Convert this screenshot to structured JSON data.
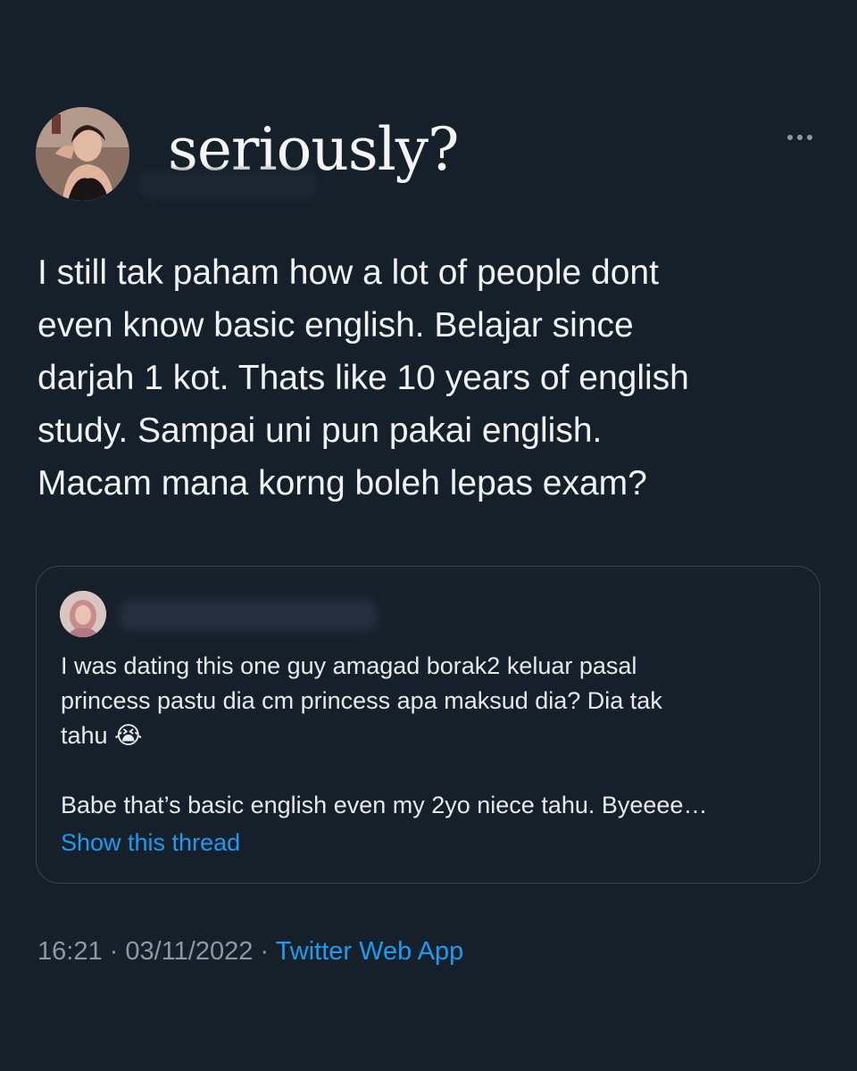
{
  "author": {
    "display_name": "seriously?",
    "avatar_icon": "profile-photo"
  },
  "more_icon": "more-horizontal-icon",
  "tweet": {
    "text": "I still tak paham how a lot of people dont\neven know basic english. Belajar since\ndarjah 1 kot. Thats like 10 years of english\nstudy. Sampai uni pun pakai english.\nMacam mana korng boleh lepas exam?"
  },
  "quoted_tweet": {
    "avatar_icon": "profile-photo",
    "text": "I was dating this one guy amagad borak2 keluar pasal\nprincess pastu dia cm princess apa maksud dia? Dia tak\ntahu 😭\n\nBabe that’s basic english even my 2yo niece tahu. Byeeee…",
    "show_thread_label": "Show this thread"
  },
  "meta": {
    "time": "16:21",
    "separator": "·",
    "date": "03/11/2022",
    "source": "Twitter Web App"
  },
  "colors": {
    "background": "#15202b",
    "link": "#1d9bf0",
    "muted": "#8b98a5",
    "border": "#38444d"
  }
}
